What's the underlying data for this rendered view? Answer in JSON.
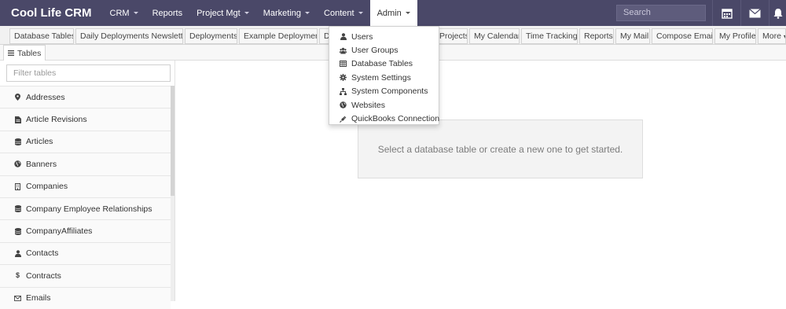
{
  "brand": "Cool Life CRM",
  "nav": [
    {
      "label": "CRM",
      "caret": true
    },
    {
      "label": "Reports",
      "caret": false
    },
    {
      "label": "Project Mgt",
      "caret": true
    },
    {
      "label": "Marketing",
      "caret": true
    },
    {
      "label": "Content",
      "caret": true
    },
    {
      "label": "Admin",
      "caret": true
    }
  ],
  "search": {
    "placeholder": "Search"
  },
  "nav_icons": [
    "calendar-icon",
    "envelope-icon",
    "bell-icon"
  ],
  "tabs": [
    "Database Tables",
    "Daily Deployments Newsletter",
    "Deployments",
    "Example Deployment",
    "D",
    "Projects",
    "My Calendar",
    "Time Tracking",
    "Reports",
    "My Mail",
    "Compose Email",
    "My Profile",
    "More"
  ],
  "section_tab": "Tables",
  "filter": {
    "placeholder": "Filter tables"
  },
  "tables": [
    {
      "label": "Addresses",
      "icon": "map-marker-icon"
    },
    {
      "label": "Article Revisions",
      "icon": "file-icon"
    },
    {
      "label": "Articles",
      "icon": "database-icon"
    },
    {
      "label": "Banners",
      "icon": "globe-icon"
    },
    {
      "label": "Companies",
      "icon": "building-icon"
    },
    {
      "label": "Company Employee Relationships",
      "icon": "database-icon"
    },
    {
      "label": "CompanyAffiliates",
      "icon": "database-icon"
    },
    {
      "label": "Contacts",
      "icon": "user-icon"
    },
    {
      "label": "Contracts",
      "icon": "dollar-icon"
    },
    {
      "label": "Emails",
      "icon": "envelope-icon"
    }
  ],
  "empty_message": "Select a database table or create a new one to get started.",
  "admin_menu": [
    {
      "label": "Users",
      "icon": "user-icon"
    },
    {
      "label": "User Groups",
      "icon": "users-icon"
    },
    {
      "label": "Database Tables",
      "icon": "table-icon"
    },
    {
      "label": "System Settings",
      "icon": "gear-icon"
    },
    {
      "label": "System Components",
      "icon": "sitemap-icon"
    },
    {
      "label": "Websites",
      "icon": "globe-icon"
    },
    {
      "label": "QuickBooks Connection",
      "icon": "plug-icon"
    }
  ],
  "colors": {
    "navbar": "#4a4868",
    "accent_text": "#ffffff"
  }
}
